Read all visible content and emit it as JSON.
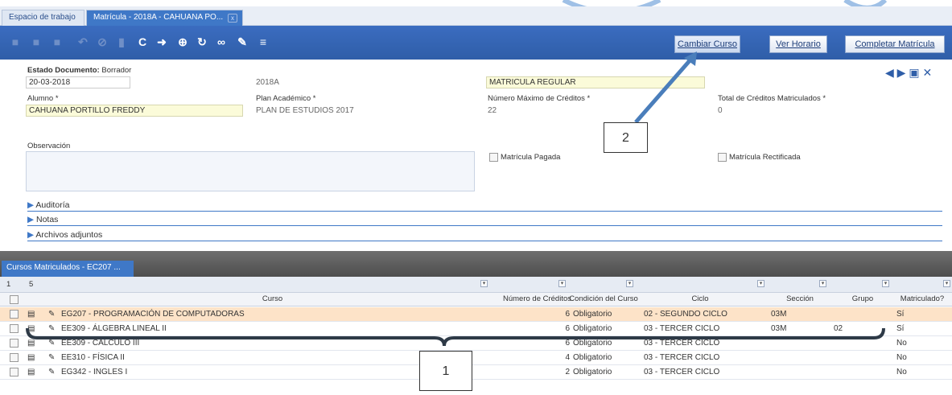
{
  "tabs": {
    "workspace": "Espacio de trabajo",
    "active": "Matrícula - 2018A - CAHUANA PO...",
    "close": "x"
  },
  "toolbar": {
    "cambiar_curso": "Cambiar Curso",
    "ver_horario": "Ver Horario",
    "completar_matricula": "Completar Matrícula"
  },
  "form": {
    "estado_label": "Estado Documento:",
    "estado_value": "Borrador",
    "fecha": "20-03-2018",
    "periodo": "2018A",
    "tipo_matricula": "MATRICULA REGULAR",
    "alumno_label": "Alumno *",
    "alumno_value": "CAHUANA PORTILLO FREDDY",
    "plan_label": "Plan Académico * ",
    "plan_value": "PLAN DE ESTUDIOS 2017",
    "max_creditos_label": "Número Máximo de Créditos *",
    "max_creditos_value": "22",
    "total_creditos_label": "Total de Créditos Matriculados *",
    "total_creditos_value": "0",
    "observacion_label": "Observación",
    "matricula_pagada": "Matrícula Pagada",
    "matricula_rectificada": "Matrícula Rectificada",
    "sections": [
      "Auditoría",
      "Notas",
      "Archivos adjuntos"
    ]
  },
  "subtab": "Cursos Matriculados - EC207 ...",
  "grid": {
    "top_counters": [
      "1",
      "5"
    ],
    "headers": {
      "curso": "Curso",
      "creditos": "Número de Créditos",
      "condicion": "Condición del Curso",
      "ciclo": "Ciclo",
      "seccion": "Sección",
      "grupo": "Grupo",
      "matriculado": "Matriculado?"
    },
    "rows": [
      {
        "curso": "EG207 - PROGRAMACIÓN DE COMPUTADORAS",
        "creditos": "6",
        "condicion": "Obligatorio",
        "ciclo": "02 - SEGUNDO CICLO",
        "seccion": "03M",
        "grupo": "",
        "matriculado": "Sí"
      },
      {
        "curso": "EE309 - ÁLGEBRA LINEAL II",
        "creditos": "6",
        "condicion": "Obligatorio",
        "ciclo": "03 - TERCER CICLO",
        "seccion": "03M",
        "grupo": "02",
        "matriculado": "Sí"
      },
      {
        "curso": "EE309 - CÁLCULO III",
        "creditos": "6",
        "condicion": "Obligatorio",
        "ciclo": "03 - TERCER CICLO",
        "seccion": "",
        "grupo": "",
        "matriculado": "No"
      },
      {
        "curso": "EE310 - FÍSICA II",
        "creditos": "4",
        "condicion": "Obligatorio",
        "ciclo": "03 - TERCER CICLO",
        "seccion": "",
        "grupo": "",
        "matriculado": "No"
      },
      {
        "curso": "EG342 - INGLES I",
        "creditos": "2",
        "condicion": "Obligatorio",
        "ciclo": "03 - TERCER CICLO",
        "seccion": "",
        "grupo": "",
        "matriculado": "No"
      }
    ]
  },
  "annotations": {
    "callout_1": "1",
    "callout_2": "2"
  },
  "colors": {
    "accent": "#3f78c7",
    "annotation": "#4a7ebb"
  }
}
